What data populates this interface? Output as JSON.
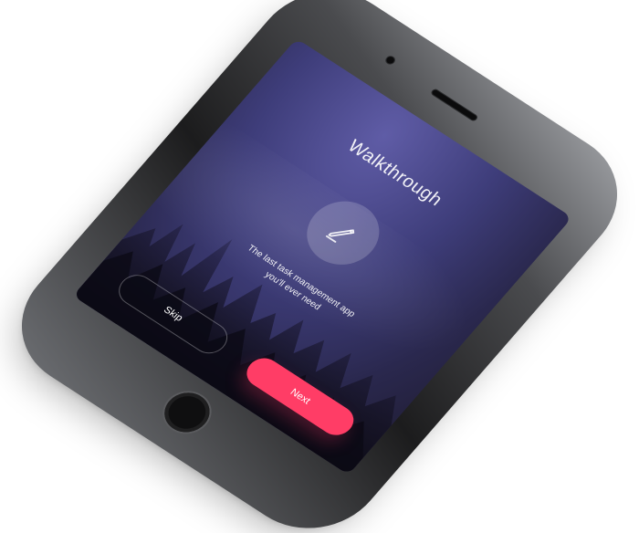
{
  "screen": {
    "title": "Walkthrough",
    "subtitle_line1": "The last task management app",
    "subtitle_line2": "you'll ever need",
    "center_icon": "pencil-icon"
  },
  "buttons": {
    "skip_label": "Skip",
    "next_label": "Next"
  },
  "colors": {
    "accent": "#ff3d66",
    "screen_bg_top": "#5f5ca6",
    "screen_bg_bottom": "#201d34"
  }
}
